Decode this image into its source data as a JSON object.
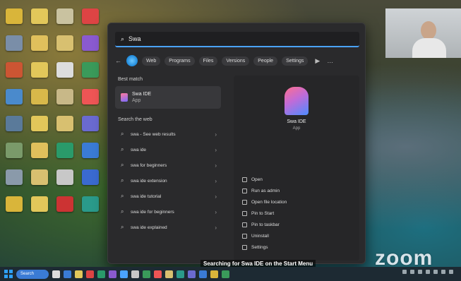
{
  "search": {
    "query": "Swa"
  },
  "filters": {
    "tabs": [
      "Web",
      "Programs",
      "Files",
      "Versions",
      "People",
      "Settings"
    ]
  },
  "best_match": {
    "section_title": "Best match",
    "app_name": "Swa IDE",
    "app_type": "App"
  },
  "search_web": {
    "section_title": "Search the web",
    "results": [
      "swa - See web results",
      "swa ide",
      "swa for beginners",
      "swa ide extension",
      "swa ide tutorial",
      "swa ide for beginners",
      "swa ide explained"
    ]
  },
  "preview": {
    "app_name": "Swa IDE",
    "app_type": "App",
    "actions": [
      "Open",
      "Run as admin",
      "Open file location",
      "Pin to Start",
      "Pin to taskbar",
      "Uninstall",
      "Settings"
    ]
  },
  "subtitle": "Searching for Swa IDE on the Start Menu",
  "zoom_logo": "zoom",
  "taskbar": {
    "search_label": "Search",
    "clock_time": "",
    "clock_date": ""
  },
  "colors": {
    "accent": "#4aa3ff",
    "panel_bg": "#2a2a2c"
  }
}
